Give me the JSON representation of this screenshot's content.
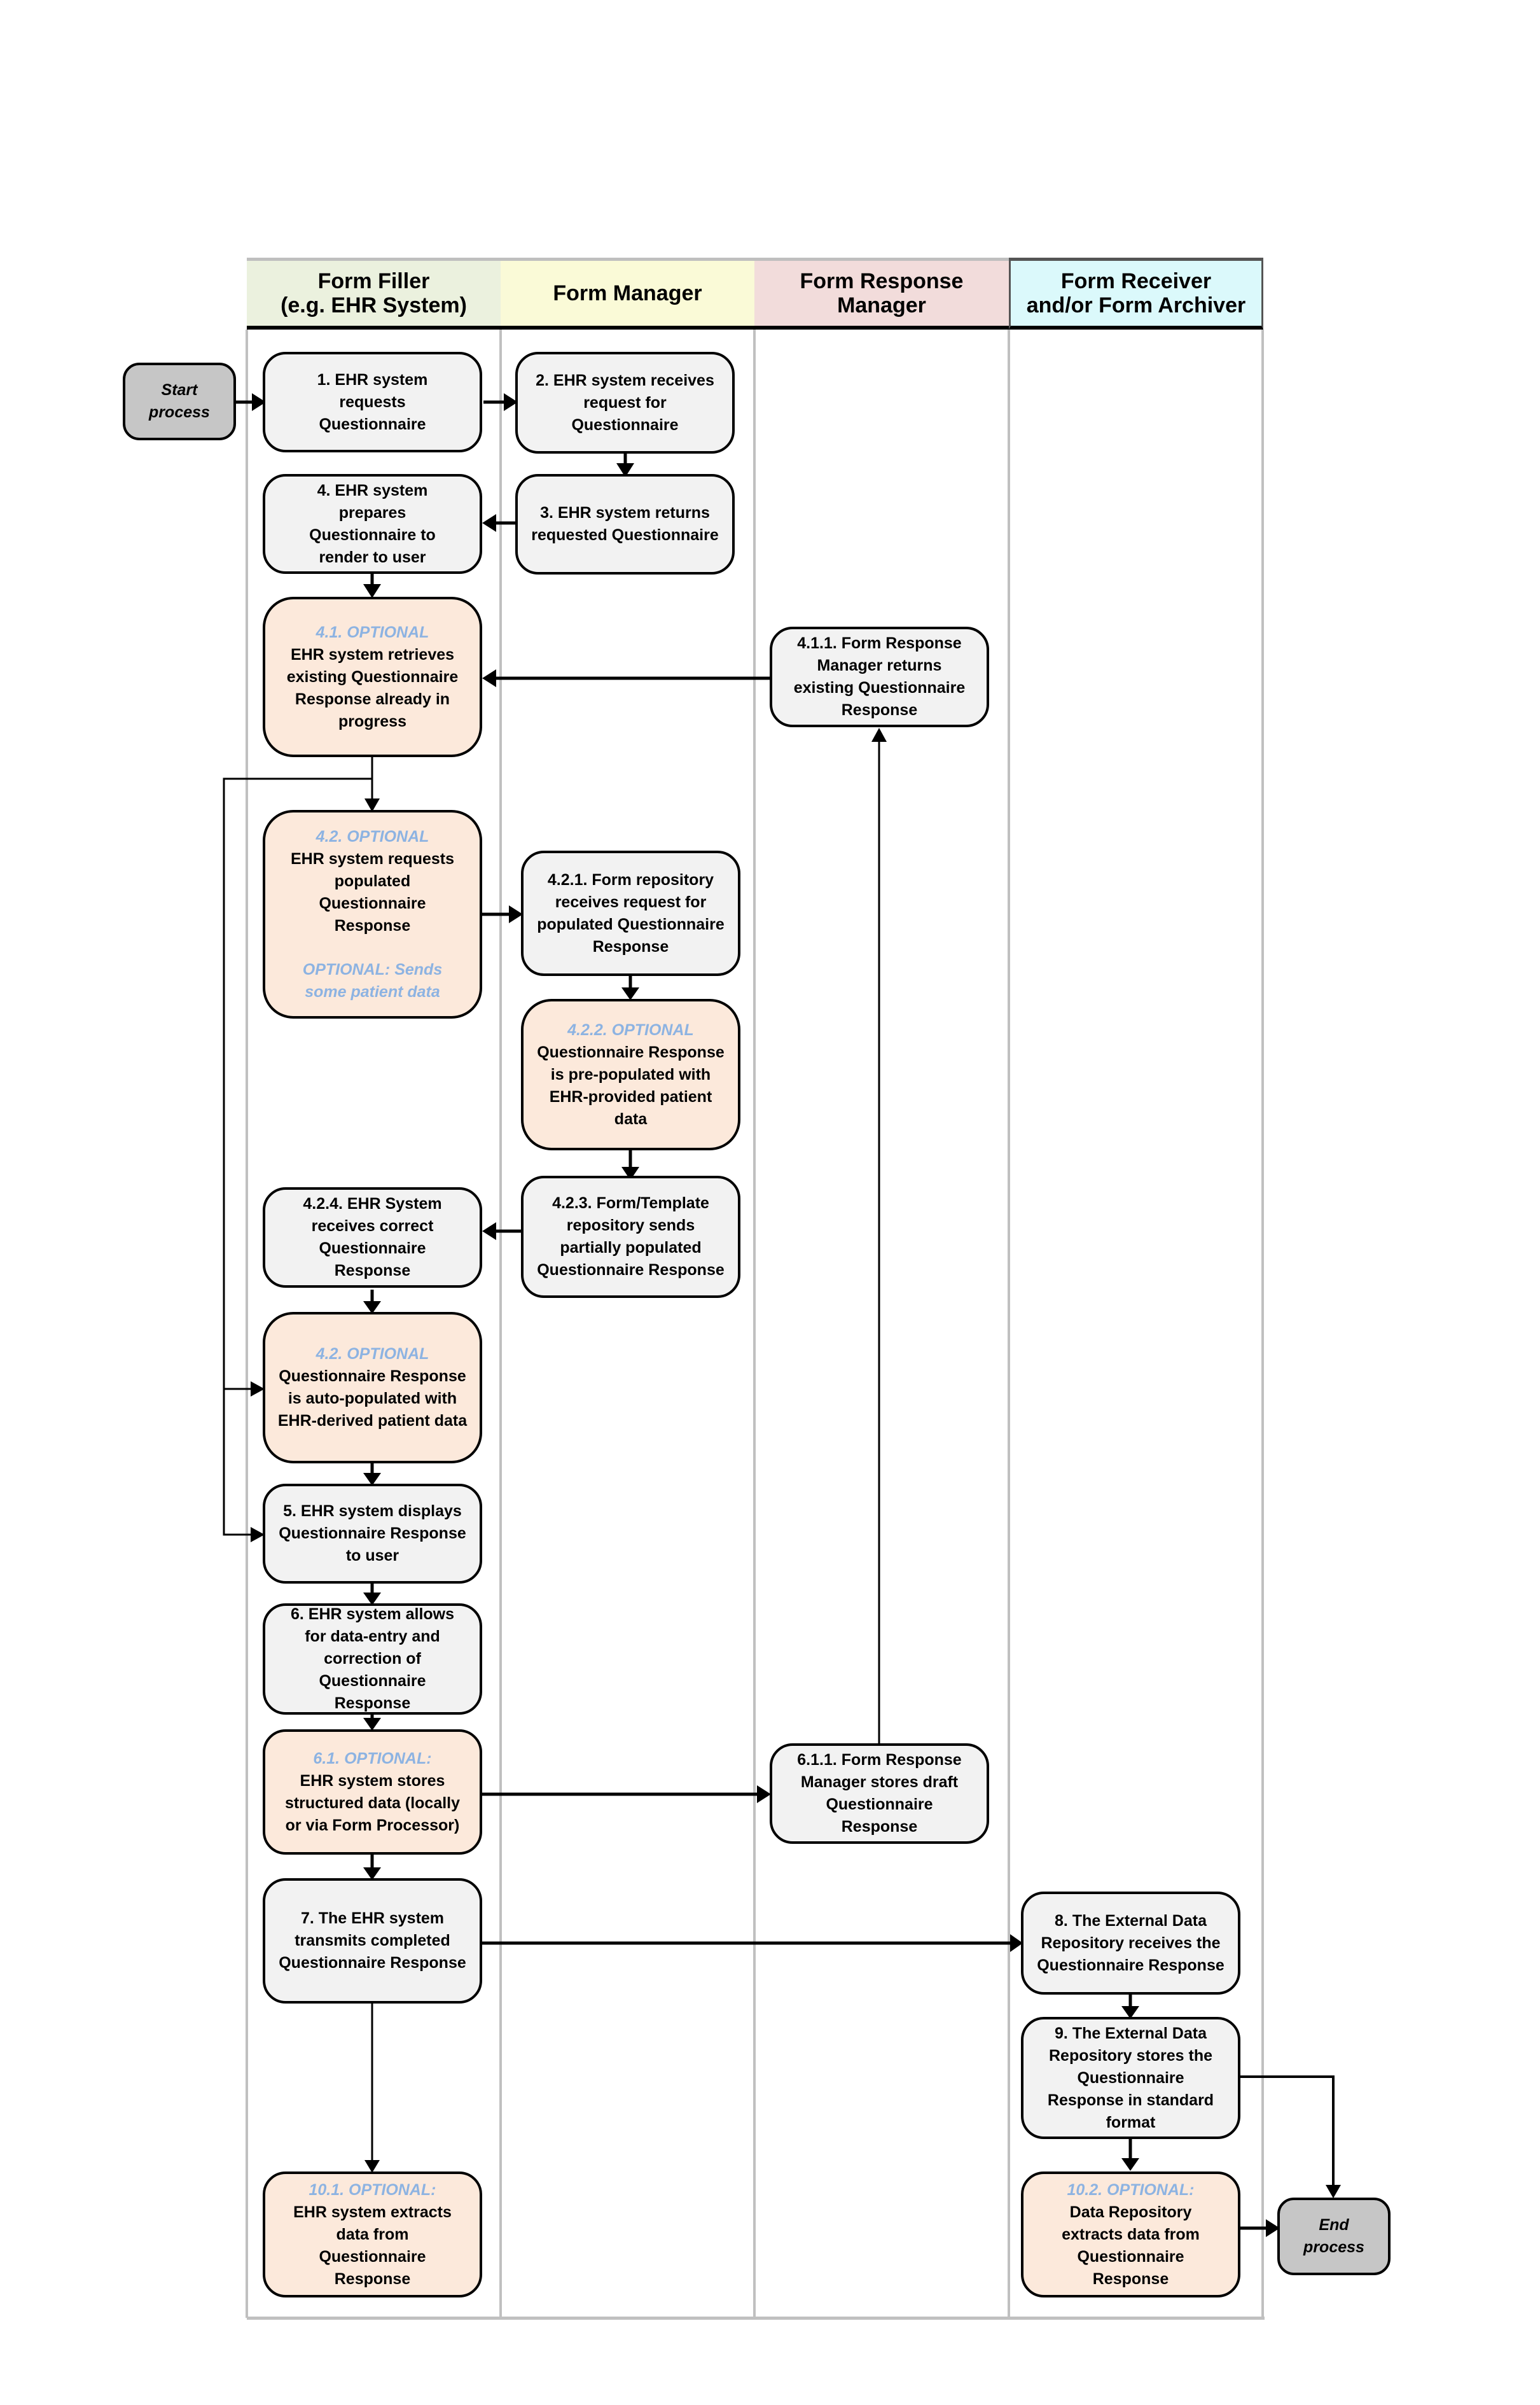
{
  "lanes": [
    {
      "title_line1": "Form Filler",
      "title_line2": "(e.g. EHR System)",
      "color": "#ebf1de"
    },
    {
      "title_line1": "Form Manager",
      "title_line2": "",
      "color": "#fafad7"
    },
    {
      "title_line1": "Form Response",
      "title_line2": "Manager",
      "color": "#f2dcdb"
    },
    {
      "title_line1": "Form Receiver",
      "title_line2": "and/or Form Archiver",
      "color": "#dbf9fb"
    }
  ],
  "terminals": {
    "start": {
      "line1": "Start",
      "line2": "process"
    },
    "end": {
      "line1": "End",
      "line2": "process"
    }
  },
  "steps": {
    "s1": {
      "text": "1. EHR system requests Questionnaire"
    },
    "s2": {
      "text": "2. EHR system receives request for Questionnaire"
    },
    "s3": {
      "text": "3. EHR system returns requested Questionnaire"
    },
    "s4": {
      "text": "4. EHR system prepares Questionnaire to render to user"
    },
    "s41": {
      "label": "4.1. OPTIONAL",
      "text": "EHR system retrieves existing Questionnaire Response already in progress"
    },
    "s411": {
      "text": "4.1.1. Form Response Manager returns existing Questionnaire Response"
    },
    "s42": {
      "label": "4.2. OPTIONAL",
      "text": "EHR system requests populated Questionnaire Response",
      "note": "OPTIONAL: Sends some patient data"
    },
    "s421": {
      "text": "4.2.1. Form repository receives request for populated Questionnaire Response"
    },
    "s422": {
      "label": "4.2.2. OPTIONAL",
      "text": "Questionnaire Response is pre-populated with EHR-provided patient data"
    },
    "s423": {
      "text": "4.2.3. Form/Template repository sends partially populated Questionnaire Response"
    },
    "s424": {
      "text": "4.2.4. EHR System receives correct Questionnaire Response"
    },
    "s42b": {
      "label": "4.2. OPTIONAL",
      "text": "Questionnaire Response is auto-populated with EHR-derived patient data"
    },
    "s5": {
      "text": "5. EHR system displays Questionnaire Response to user"
    },
    "s6": {
      "text": "6. EHR system allows for data-entry and correction of Questionnaire Response"
    },
    "s61": {
      "label": "6.1. OPTIONAL:",
      "text": "EHR system stores structured data (locally or via Form Processor)"
    },
    "s611": {
      "text": "6.1.1. Form Response Manager stores draft Questionnaire Response"
    },
    "s7": {
      "text": "7. The EHR system transmits completed Questionnaire Response"
    },
    "s8": {
      "text": "8. The External Data Repository receives the Questionnaire Response"
    },
    "s9": {
      "text": "9. The External Data Repository stores the Questionnaire Response in standard format"
    },
    "s101": {
      "label": "10.1. OPTIONAL:",
      "text": "EHR system extracts data from Questionnaire Response"
    },
    "s102": {
      "label": "10.2. OPTIONAL:",
      "text": "Data Repository extracts data from Questionnaire Response"
    }
  },
  "colors": {
    "step_fill": "#f2f2f2",
    "optional_fill": "#fce9db",
    "terminal_fill": "#c6c6c6",
    "optional_label": "#8db3e2"
  }
}
